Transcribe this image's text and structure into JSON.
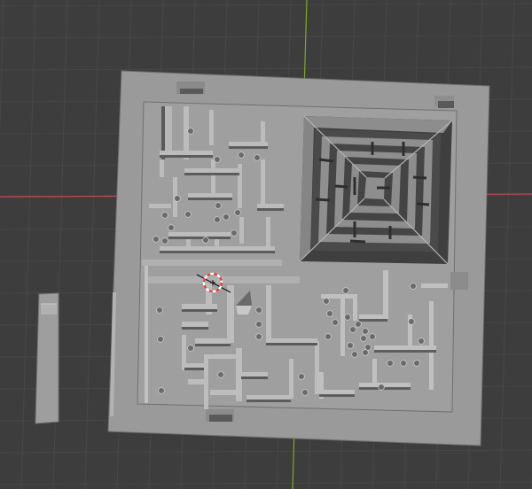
{
  "viewport": {
    "background": "#3d3d3d",
    "grid_color": "#474747",
    "x_axis_color": "#c2444f",
    "y_axis_color": "#7fa828"
  },
  "model": {
    "main_color": "#9b9b9b",
    "top_face_color": "#a4a4a4",
    "shadow_color": "#2a2a2a",
    "edge_color": "#b8b8b8"
  },
  "cursor_3d": {
    "ring_colors": [
      "#e23b3b",
      "#ffffff"
    ],
    "crosshair_color": "#111111"
  }
}
